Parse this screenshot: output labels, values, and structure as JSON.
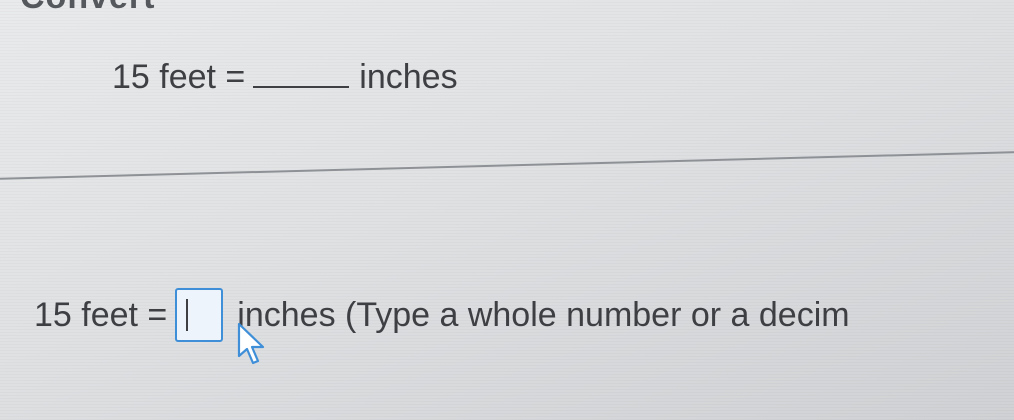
{
  "header_fragment": "Convert",
  "question": {
    "lhs": "15 feet =",
    "unit": "inches"
  },
  "answer": {
    "lhs": "15 feet =",
    "input_value": "",
    "instruction": "inches (Type a whole number or a decim"
  },
  "colors": {
    "input_border": "#3f8fd8",
    "text": "#3d3f43"
  },
  "icons": [
    "pointer-cursor-icon"
  ]
}
